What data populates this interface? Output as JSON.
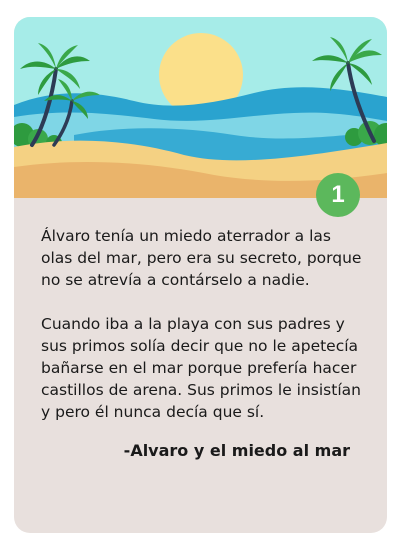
{
  "card": {
    "badge_number": "1",
    "paragraphs": [
      "Álvaro tenía un miedo aterrador a las olas del mar, pero era su secreto, porque no se atrevía a contárselo a nadie.",
      "Cuando iba a la playa con sus padres y sus primos solía decir que no le apetecía bañarse en el mar porque prefería hacer castillos de arena. Sus primos le insistían y pero él nunca decía que sí."
    ],
    "signature": "-Alvaro y el miedo al mar"
  },
  "colors": {
    "card_background": "#e8e0dd",
    "sky": "#a6ece8",
    "sun": "#fbe08a",
    "sea_dark": "#2aa3cf",
    "sea_light": "#7fd6e6",
    "sand_light": "#f4d183",
    "sand_dark": "#eab46b",
    "palm_leaf": "#2e9b3f",
    "palm_trunk": "#2d3b55",
    "badge": "#5cb85c"
  }
}
